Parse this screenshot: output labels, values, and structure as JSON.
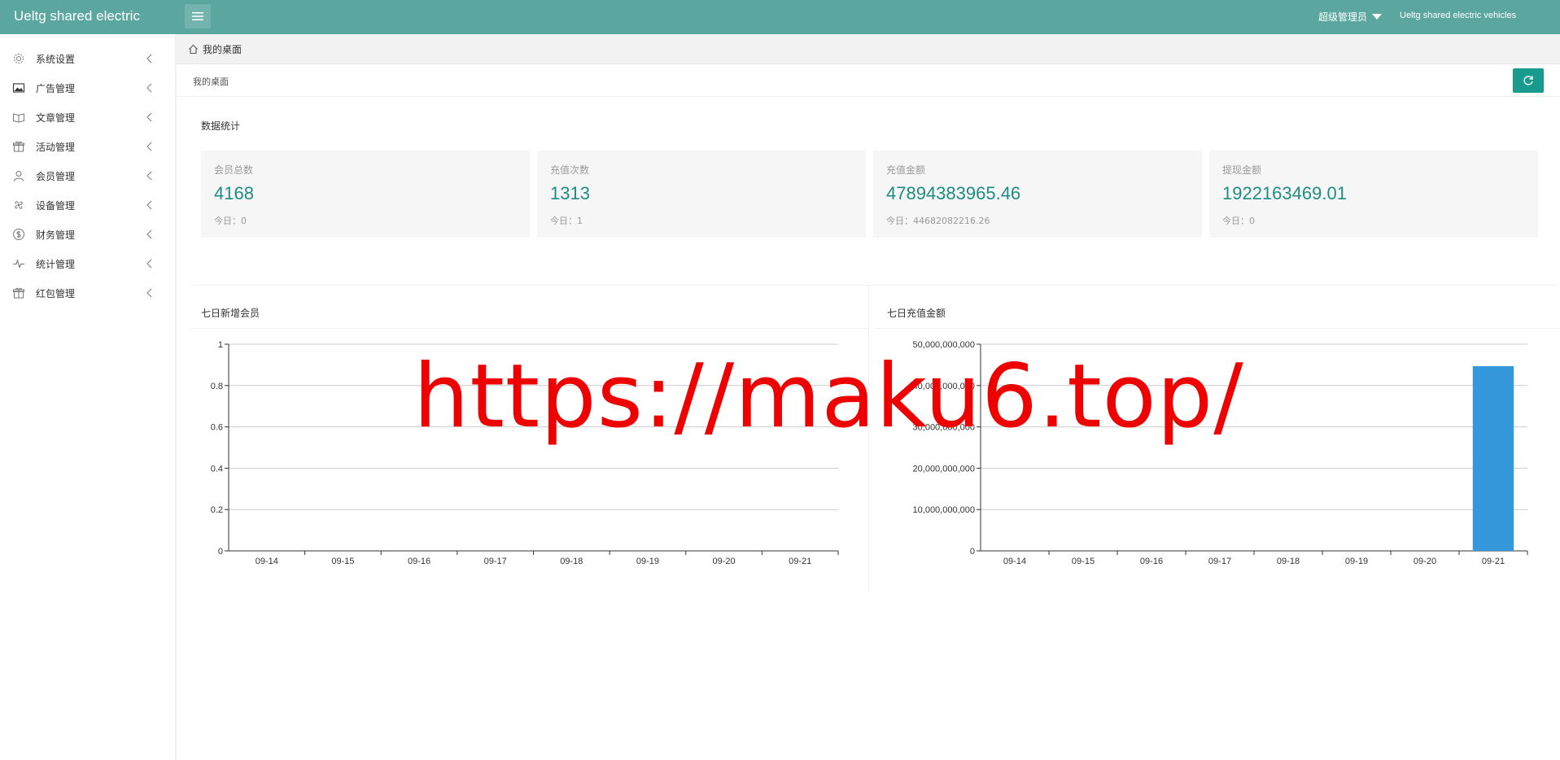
{
  "header": {
    "app_title": "Ueltg shared electric",
    "user_name": "超级管理员",
    "site_name": "Ueltg shared electric vehicles"
  },
  "sidebar": {
    "items": [
      {
        "label": "系统设置",
        "icon": "gear-icon"
      },
      {
        "label": "广告管理",
        "icon": "image-icon"
      },
      {
        "label": "文章管理",
        "icon": "book-icon"
      },
      {
        "label": "活动管理",
        "icon": "gift-icon"
      },
      {
        "label": "会员管理",
        "icon": "user-icon"
      },
      {
        "label": "设备管理",
        "icon": "fan-icon"
      },
      {
        "label": "财务管理",
        "icon": "dollar-icon"
      },
      {
        "label": "统计管理",
        "icon": "pulse-icon"
      },
      {
        "label": "红包管理",
        "icon": "gift-icon"
      }
    ]
  },
  "tabs": {
    "home_label": "我的桌面"
  },
  "breadcrumb": {
    "label": "我的桌面"
  },
  "stats": {
    "title": "数据统计",
    "cards": [
      {
        "name": "会员总数",
        "value": "4168",
        "today": "今日：0"
      },
      {
        "name": "充值次数",
        "value": "1313",
        "today": "今日：1"
      },
      {
        "name": "充值金额",
        "value": "47894383965.46",
        "today": "今日：44682082216.26"
      },
      {
        "name": "提现金额",
        "value": "1922163469.01",
        "today": "今日：0"
      }
    ]
  },
  "colors": {
    "topbar": "#5ba7a0",
    "accent": "#169b8d",
    "stat_value": "#1e8c80",
    "bar": "#3498db"
  },
  "watermark": "https://maku6.top/",
  "chart_data": [
    {
      "type": "line",
      "title": "七日新增会员",
      "categories": [
        "09-14",
        "09-15",
        "09-16",
        "09-17",
        "09-18",
        "09-19",
        "09-20",
        "09-21"
      ],
      "values": [
        0,
        0,
        0,
        0,
        0,
        0,
        0,
        0
      ],
      "yticks": [
        "0",
        "0.2",
        "0.4",
        "0.6",
        "0.8",
        "1"
      ],
      "ylim": [
        0,
        1
      ],
      "grid": true
    },
    {
      "type": "bar",
      "title": "七日充值金额",
      "categories": [
        "09-14",
        "09-15",
        "09-16",
        "09-17",
        "09-18",
        "09-19",
        "09-20",
        "09-21"
      ],
      "values": [
        0,
        0,
        0,
        0,
        0,
        0,
        0,
        44682082216.26
      ],
      "yticks": [
        "0",
        "10,000,000,000",
        "20,000,000,000",
        "30,000,000,000",
        "40,000,000,000",
        "50,000,000,000"
      ],
      "ylim": [
        0,
        50000000000
      ],
      "grid": true
    }
  ]
}
